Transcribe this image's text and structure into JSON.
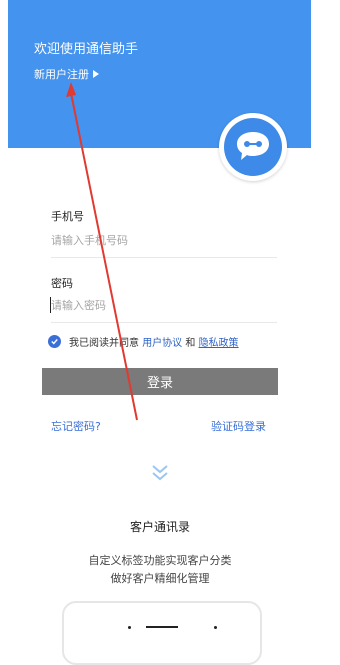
{
  "header": {
    "welcome": "欢迎使用通信助手",
    "register": "新用户注册"
  },
  "form": {
    "phone_label": "手机号",
    "phone_placeholder": "请输入手机号码",
    "password_label": "密码",
    "password_placeholder": "请输入密码"
  },
  "agreement": {
    "prefix": "我已阅读并同意",
    "user_agreement": "用户协议",
    "and": "和",
    "privacy_policy": "隐私政策"
  },
  "actions": {
    "login": "登录",
    "forgot_password": "忘记密码?",
    "code_login": "验证码登录"
  },
  "feature": {
    "title": "客户通讯录",
    "line1": "自定义标签功能实现客户分类",
    "line2": "做好客户精细化管理"
  },
  "colors": {
    "header_bg": "#4493ee",
    "accent": "#3a6fd8",
    "button_bg": "#7a7a7a",
    "annotation": "#e03a32"
  },
  "icons": {
    "logo": "chat-bot-icon",
    "register_arrow": "play-triangle-icon",
    "check": "check-circle-icon",
    "scroll": "double-chevron-down-icon"
  }
}
